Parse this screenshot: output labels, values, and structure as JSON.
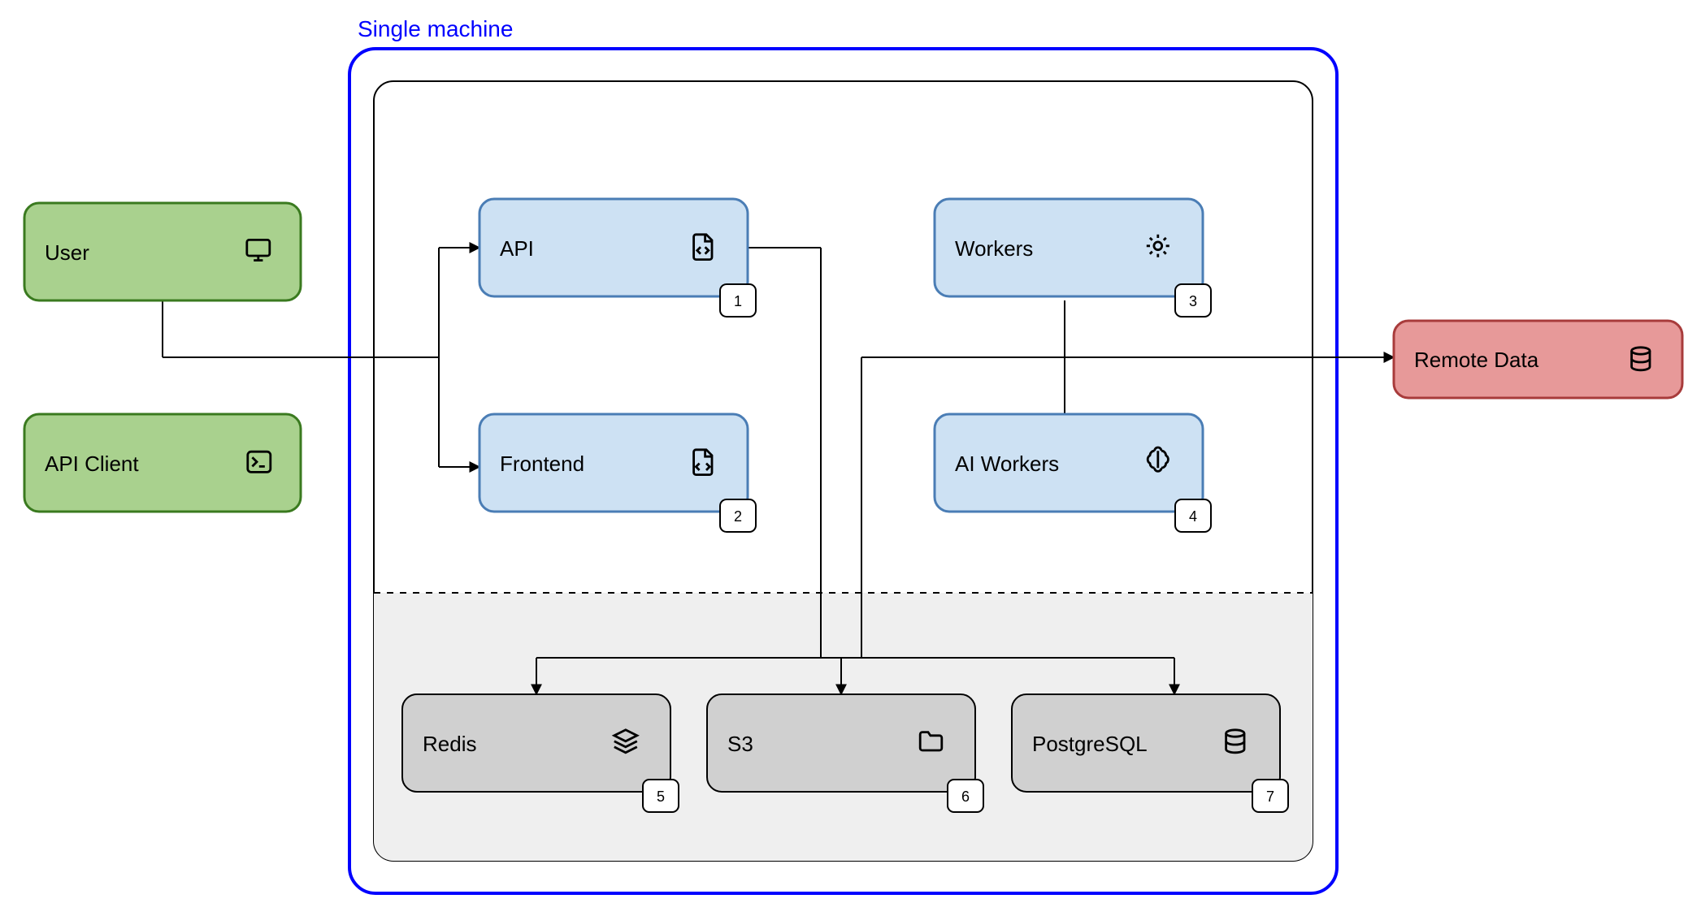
{
  "diagram": {
    "container_title": "Single machine",
    "nodes": {
      "user": {
        "label": "User",
        "icon": "monitor-icon",
        "badge": null,
        "color": "green"
      },
      "api_client": {
        "label": "API Client",
        "icon": "terminal-icon",
        "badge": null,
        "color": "green"
      },
      "api": {
        "label": "API",
        "icon": "code-file-icon",
        "badge": "1",
        "color": "blue"
      },
      "frontend": {
        "label": "Frontend",
        "icon": "html-file-icon",
        "badge": "2",
        "color": "blue"
      },
      "workers": {
        "label": "Workers",
        "icon": "gear-icon",
        "badge": "3",
        "color": "blue"
      },
      "ai_workers": {
        "label": "AI Workers",
        "icon": "brain-icon",
        "badge": "4",
        "color": "blue"
      },
      "redis": {
        "label": "Redis",
        "icon": "stack-icon",
        "badge": "5",
        "color": "grey"
      },
      "s3": {
        "label": "S3",
        "icon": "folder-icon",
        "badge": "6",
        "color": "grey"
      },
      "postgresql": {
        "label": "PostgreSQL",
        "icon": "database-icon",
        "badge": "7",
        "color": "grey"
      },
      "remote_data": {
        "label": "Remote Data",
        "icon": "database-icon",
        "badge": null,
        "color": "red"
      }
    },
    "edges": [
      {
        "from": "user",
        "to": "api",
        "directed": true
      },
      {
        "from": "user",
        "to": "frontend",
        "directed": true
      },
      {
        "from": "api_client",
        "to": "api",
        "directed": true
      },
      {
        "from": "api_client",
        "to": "frontend",
        "directed": true
      },
      {
        "from": "api",
        "to": "redis",
        "directed": true
      },
      {
        "from": "api",
        "to": "s3",
        "directed": true
      },
      {
        "from": "api",
        "to": "postgresql",
        "directed": true
      },
      {
        "from": "workers",
        "to": "redis",
        "directed": true
      },
      {
        "from": "workers",
        "to": "s3",
        "directed": true
      },
      {
        "from": "workers",
        "to": "postgresql",
        "directed": true
      },
      {
        "from": "ai_workers",
        "to": "redis",
        "directed": true
      },
      {
        "from": "ai_workers",
        "to": "s3",
        "directed": true
      },
      {
        "from": "ai_workers",
        "to": "postgresql",
        "directed": true
      },
      {
        "from": "workers",
        "to": "ai_workers",
        "directed": false
      },
      {
        "from": "workers",
        "to": "remote_data",
        "directed": true
      },
      {
        "from": "ai_workers",
        "to": "remote_data",
        "directed": true
      }
    ],
    "colors": {
      "green_fill": "#a9d18e",
      "green_stroke": "#3a7a1f",
      "blue_fill": "#cde1f3",
      "blue_stroke": "#4a7db5",
      "grey_fill": "#d0d0d0",
      "grey_stroke": "#000000",
      "red_fill": "#e79999",
      "red_stroke": "#a83b3b",
      "container_stroke": "#0000ff",
      "inner_stroke": "#000000",
      "storage_zone_fill": "#efefef"
    }
  }
}
